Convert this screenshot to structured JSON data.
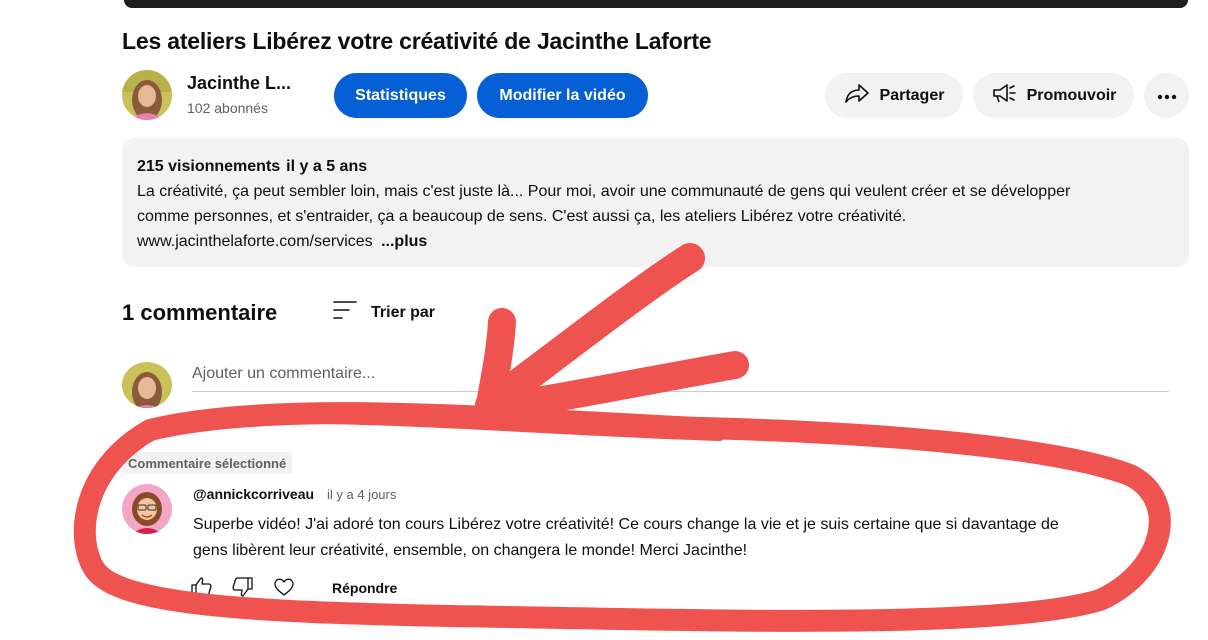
{
  "video": {
    "title": "Les ateliers Libérez votre créativité de Jacinthe Laforte"
  },
  "channel": {
    "name": "Jacinthe L...",
    "subscribers": "102 abonnés"
  },
  "actions": {
    "stats_label": "Statistiques",
    "edit_label": "Modifier la vidéo",
    "share_label": "Partager",
    "promote_label": "Promouvoir"
  },
  "description": {
    "views": "215 visionnements",
    "age": "il y a 5 ans",
    "line1": "La créativité, ça peut sembler loin, mais c'est juste là... Pour moi, avoir une communauté de gens qui veulent créer et se développer",
    "line2": "comme personnes, et s'entraider, ça a beaucoup de sens. C'est aussi ça, les ateliers Libérez votre créativité.",
    "link": "www.jacinthelaforte.com/services",
    "more_label": "...plus"
  },
  "comments": {
    "count_label": "1 commentaire",
    "sort_label": "Trier par",
    "add_placeholder": "Ajouter un commentaire...",
    "selected_badge": "Commentaire sélectionné",
    "items": [
      {
        "author": "@annickcorriveau",
        "time": "il y a 4 jours",
        "line1": "Superbe vidéo! J'ai adoré ton cours Libérez votre créativité! Ce cours change la vie et je suis certaine que si davantage de",
        "line2": "gens libèrent leur créativité, ensemble, on changera le monde! Merci Jacinthe!",
        "reply_label": "Répondre"
      }
    ]
  },
  "colors": {
    "primary_button": "#065fd4",
    "annotation": "#ef5350",
    "secondary_text": "#606060",
    "chip_background": "#f2f2f2"
  },
  "icons": [
    "share-icon",
    "megaphone-icon",
    "more-icon",
    "sort-icon",
    "like-icon",
    "dislike-icon",
    "heart-icon"
  ]
}
